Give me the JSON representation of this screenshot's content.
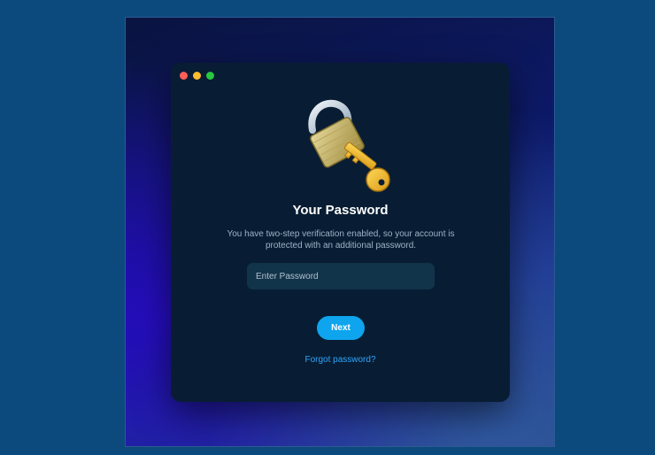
{
  "dialog": {
    "title": "Your Password",
    "description": "You have two-step verification enabled, so your account is protected with an additional password.",
    "password_placeholder": "Enter Password",
    "next_label": "Next",
    "forgot_label": "Forgot password?",
    "icon": "lock-and-key-icon"
  },
  "colors": {
    "accent": "#0ea5ee",
    "link": "#2ea6ff",
    "window_bg": "#081d33"
  }
}
